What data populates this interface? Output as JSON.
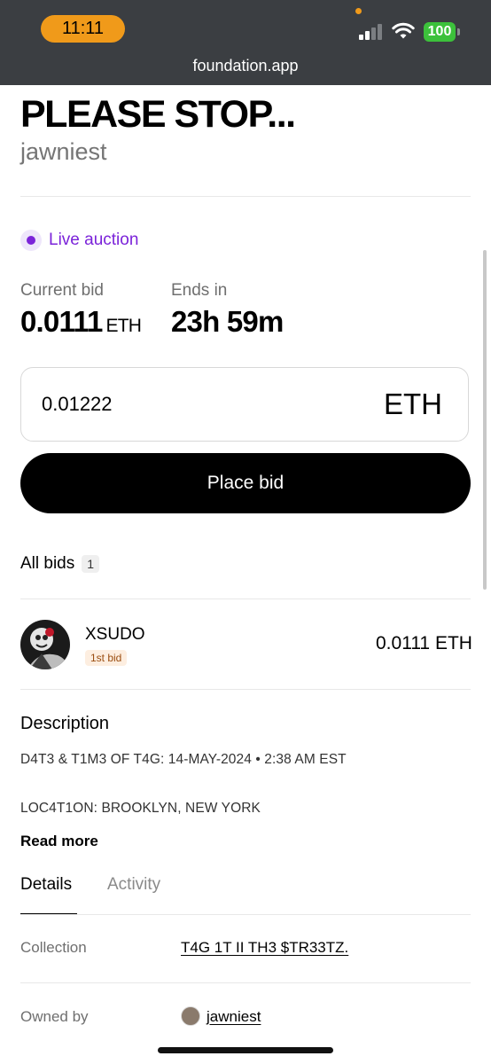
{
  "status_bar": {
    "time": "11:11",
    "battery": "100",
    "icons": [
      "cellular-signal-icon",
      "wifi-icon",
      "battery-icon"
    ],
    "colors": {
      "time_pill": "#f09a1a",
      "battery": "#3cc13b",
      "bar": "#3b3e42"
    }
  },
  "browser": {
    "url": "foundation.app"
  },
  "artwork": {
    "title": "PLEASE STOP...",
    "artist": "jawniest"
  },
  "auction": {
    "status_label": "Live auction",
    "current_bid_label": "Current bid",
    "current_bid_value": "0.0111",
    "current_bid_unit": "ETH",
    "ends_in_label": "Ends in",
    "ends_in_value": "23h 59m",
    "accent_color": "#7b23d9"
  },
  "bid_form": {
    "amount": "0.01222",
    "unit": "ETH",
    "button_label": "Place bid"
  },
  "bids": {
    "heading": "All bids",
    "count": "1",
    "items": [
      {
        "bidder": "XSUDO",
        "tag": "1st bid",
        "amount": "0.0111 ETH"
      }
    ]
  },
  "description": {
    "heading": "Description",
    "line1": "D4T3 & T1M3 OF T4G: 14-MAY-2024 • 2:38 AM EST",
    "line2": "LOC4T1ON: BROOKLYN, NEW YORK",
    "read_more": "Read more"
  },
  "tabs": {
    "details": "Details",
    "activity": "Activity",
    "active": "Details"
  },
  "details": {
    "collection_label": "Collection",
    "collection_value": "T4G 1T II TH3 $TR33TZ.",
    "owner_label": "Owned by",
    "owner_value": "jawniest"
  }
}
